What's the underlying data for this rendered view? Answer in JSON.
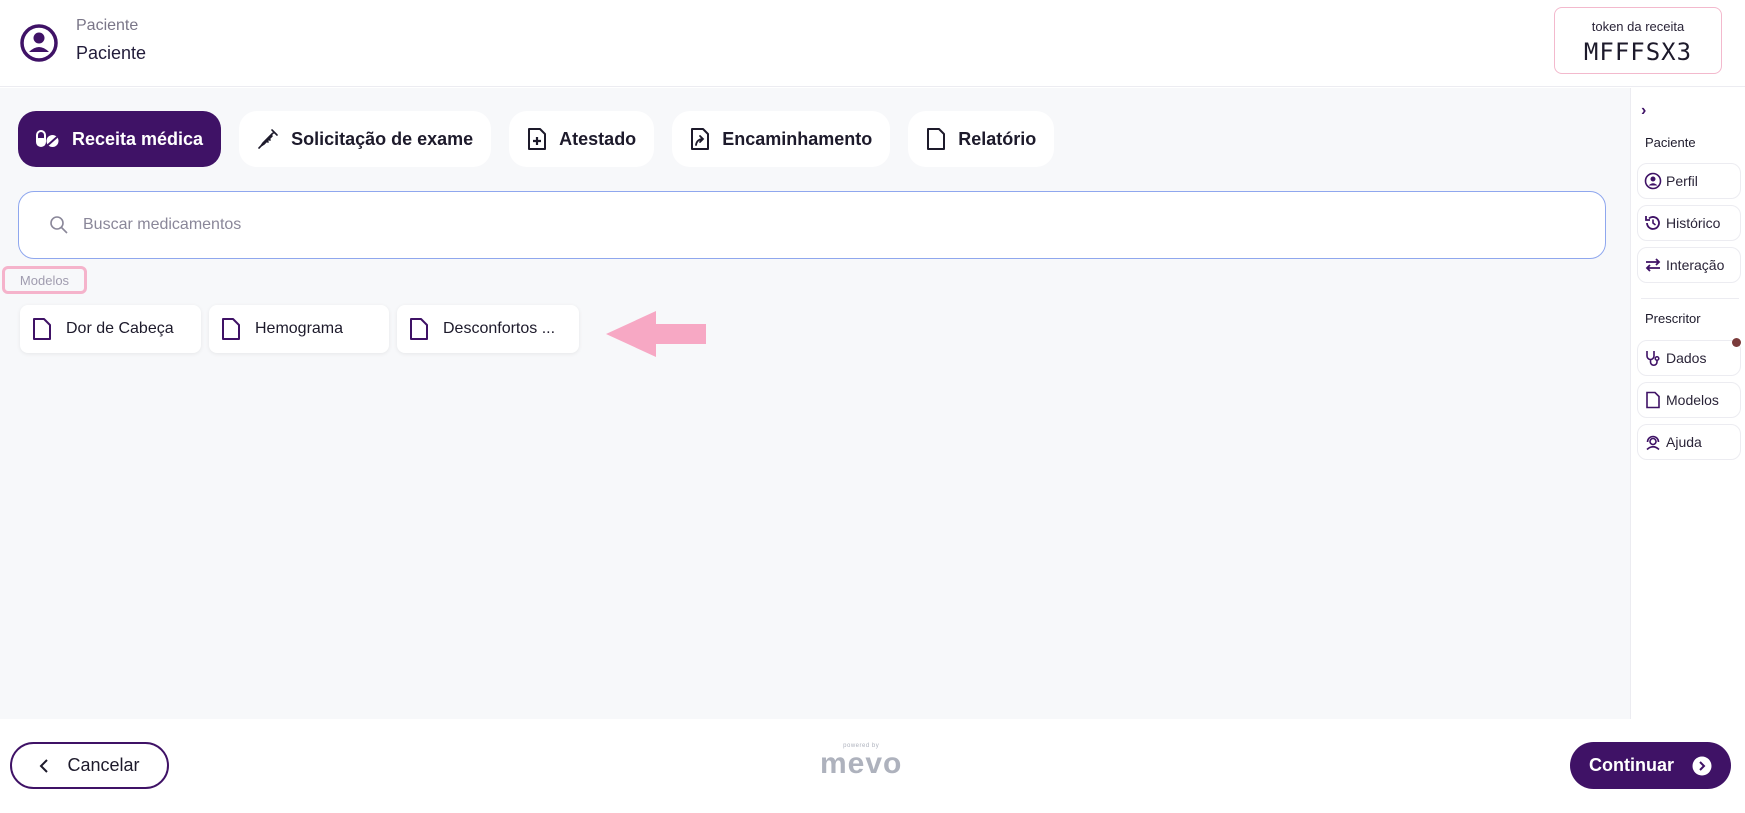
{
  "header": {
    "patient_label": "Paciente",
    "patient_name": "Paciente",
    "token_label": "token da receita",
    "token_value": "MFFFSX3"
  },
  "tabs": [
    {
      "label": "Receita médica",
      "icon": "pills-icon",
      "active": true
    },
    {
      "label": "Solicitação de exame",
      "icon": "syringe-icon",
      "active": false
    },
    {
      "label": "Atestado",
      "icon": "medical-document-icon",
      "active": false
    },
    {
      "label": "Encaminhamento",
      "icon": "referral-document-icon",
      "active": false
    },
    {
      "label": "Relatório",
      "icon": "document-icon",
      "active": false
    }
  ],
  "search": {
    "placeholder": "Buscar medicamentos",
    "value": ""
  },
  "models": {
    "label": "Modelos",
    "items": [
      {
        "label": "Dor de Cabeça"
      },
      {
        "label": "Hemograma"
      },
      {
        "label": "Desconfortos ..."
      }
    ]
  },
  "sidebar": {
    "patient_section": "Paciente",
    "patient_items": [
      {
        "label": "Perfil",
        "icon": "user-circle-icon"
      },
      {
        "label": "Histórico",
        "icon": "history-icon"
      },
      {
        "label": "Interação",
        "icon": "swap-arrows-icon"
      }
    ],
    "prescriber_section": "Prescritor",
    "prescriber_items": [
      {
        "label": "Dados",
        "icon": "stethoscope-icon"
      },
      {
        "label": "Modelos",
        "icon": "document-icon"
      },
      {
        "label": "Ajuda",
        "icon": "support-agent-icon"
      }
    ]
  },
  "footer": {
    "cancel_label": "Cancelar",
    "brand_powered": "powered by",
    "brand_name": "mevo",
    "continue_label": "Continuar"
  },
  "colors": {
    "primary": "#3f1266",
    "highlight": "#f5b3cb",
    "search_border": "#8fa7ee"
  }
}
